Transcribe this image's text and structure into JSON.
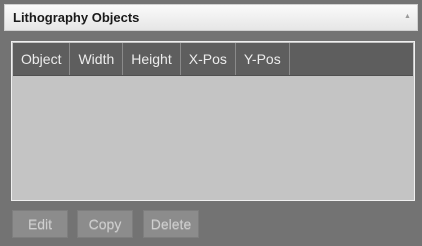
{
  "panel": {
    "title": "Lithography Objects",
    "collapse_icon": "chevron-up-icon"
  },
  "table": {
    "columns": [
      "Object",
      "Width",
      "Height",
      "X-Pos",
      "Y-Pos"
    ],
    "rows": []
  },
  "actions": {
    "edit_label": "Edit",
    "copy_label": "Copy",
    "delete_label": "Delete"
  }
}
